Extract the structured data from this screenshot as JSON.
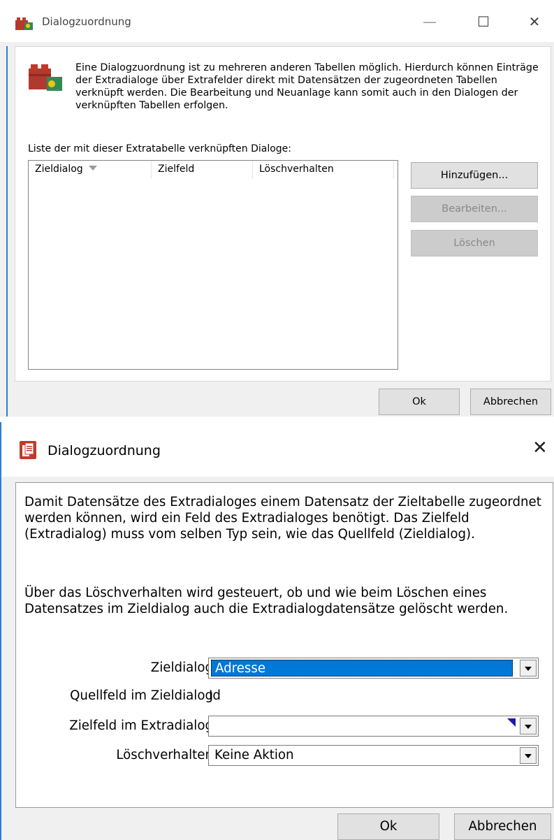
{
  "dialog1": {
    "title": "Dialogzuordnung",
    "info_text": "Eine Dialogzuordnung ist zu mehreren anderen Tabellen möglich. Hierdurch können Einträge der Extradialoge über Extrafelder direkt mit Datensätzen der zugeordneten Tabellen verknüpft werden. Die Bearbeitung und Neuanlage kann somit auch in den Dialogen der verknüpften Tabellen erfolgen.",
    "list_caption": "Liste der mit dieser Extratabelle verknüpften Dialoge:",
    "columns": [
      "Zieldialog",
      "Zielfeld",
      "Löschverhalten"
    ],
    "rows": [],
    "buttons": {
      "add": "Hinzufügen...",
      "edit": "Bearbeiten...",
      "delete": "Löschen"
    },
    "footer": {
      "ok": "Ok",
      "cancel": "Abbrechen"
    },
    "window_controls": {
      "minimize": "—",
      "maximize": "☐",
      "close": "✕"
    }
  },
  "dialog2": {
    "title": "Dialogzuordnung",
    "close_glyph": "✕",
    "paragraph1": "Damit Datensätze des Extradialoges einem Datensatz der Zieltabelle zugeordnet werden können, wird ein Feld des Extradialoges benötigt. Das Zielfeld (Extradialog) muss vom selben Typ sein, wie das Quellfeld (Zieldialog).",
    "paragraph2": "Über das Löschverhalten wird gesteuert, ob und wie beim Löschen eines Datensatzes im Zieldialog auch die Extradialogdatensätze gelöscht werden.",
    "fields": {
      "zieldialog_label": "Zieldialog",
      "zieldialog_value": "Adresse",
      "quellfeld_label": "Quellfeld im Zieldialog",
      "quellfeld_value": "Id",
      "zielfeld_label": "Zielfeld im Extradialog",
      "zielfeld_value": "",
      "loeschverhalten_label": "Löschverhalten",
      "loeschverhalten_value": "Keine Aktion"
    },
    "footer": {
      "ok": "Ok",
      "cancel": "Abbrechen"
    }
  },
  "colors": {
    "accent_blue": "#0078d7",
    "frame_blue": "#2b7fd6",
    "dialog_bg": "#f0f0f0",
    "icon_red": "#c0392b",
    "icon_green": "#2e8b57"
  }
}
